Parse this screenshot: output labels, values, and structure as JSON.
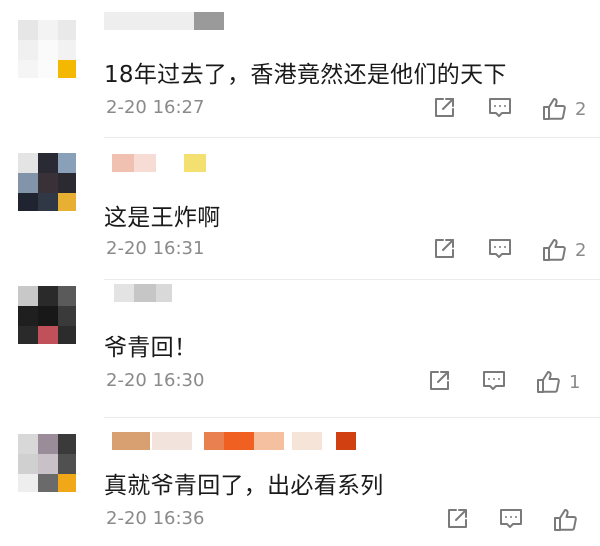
{
  "comments": [
    {
      "text": "18年过去了，香港竟然还是他们的天下",
      "time": "2-20 16:27",
      "likes": "2"
    },
    {
      "text": "这是王炸啊",
      "time": "2-20 16:31",
      "likes": "2"
    },
    {
      "text": "爷青回！",
      "time": "2-20 16:30",
      "likes": "1"
    },
    {
      "text": "真就爷青回了，出必看系列",
      "time": "2-20 16:36",
      "likes": ""
    }
  ],
  "icons": {
    "share": "share-icon",
    "reply": "comment-icon",
    "like": "thumbs-up-icon"
  },
  "colors": {
    "text": "#1a1a1a",
    "meta": "#8a8a8a",
    "icon": "#7a7a7a",
    "divider": "#ececec"
  }
}
